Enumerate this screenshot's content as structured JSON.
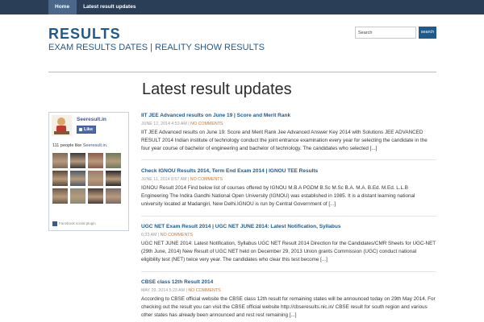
{
  "nav": {
    "home": "Home",
    "latest": "Latest result updates"
  },
  "header": {
    "title": "RESULTS",
    "description": "EXAM RESULTS DATES | REALITY SHOW RESULTS"
  },
  "search": {
    "value": "Search",
    "button": "search"
  },
  "page": {
    "title": "Latest result updates"
  },
  "facebook": {
    "page_name": "Seeresult.in",
    "like_label": "Like",
    "count_text": "111 people like ",
    "count_link": "Seeresult.in.",
    "plugin_text": "Facebook social plugin",
    "face_colors": [
      "#7d6a5a",
      "#3a3a3a",
      "#8a5a4a",
      "#6a7a5a",
      "#5a4a3a",
      "#4a5a6a",
      "#9a7a6a",
      "#2a2a2a",
      "#6a5a4a",
      "#8a8a7a",
      "#4a3a3a",
      "#7a6a6a"
    ]
  },
  "posts": [
    {
      "title": "IIT JEE Advanced results on June 19 | Score and Merit Rank",
      "date": "JUNE 12, 2014 4:53 AM | ",
      "comments": "NO COMMENTS",
      "excerpt": "IIT JEE Advanced results on June 19: Score and Merit Rank Jee Advanced Answer Key 2014 with Solutions JEE ADVANCED RESULT 2014 Indian institute of technology conduct the joint entrance examination every year for selecting the candidate in the four year course of bachelor of engineering and bachelor of technology. The candidates who selected [...]"
    },
    {
      "title": "Check IGNOU Results 2014, Term End Exam 2014 | IGNOU TEE Results",
      "date": "JUNE 11, 2014 8:57 AM | ",
      "comments": "NO COMMENTS",
      "excerpt": "IGNOU Result 2014 Find below list of courses offered by IGNOU M.B.A PGDM B.Sc M.Sc B.A. M.A. B.Ed. M.Ed. L.L.B Engineering The Indira Gandhi National Open University (IGNOU) was established in 1985. It is a distant learning national university located at Madangiri, New Delhi.IGNOU is run by Central Government of [...]"
    },
    {
      "title": "UGC NET Exam Result 2014 | UGC NET JUNE 2014: Latest Notification, Syllabus",
      "date": "6:33 AM | ",
      "comments": "NO COMMENTS",
      "excerpt": "UGC NET JUNE 2014: Latest Notification, Syllabus UGC NET Result 2014 Direction for the Candidates/CMR Sheets for UGC-NET (29th June, 2014) New Result of UGC NET held on December 29, 2013 Union grants Commission (UGC) conduct national eligibility test (NET) twice very year. The candidates who clear this test become [...]"
    },
    {
      "title": "CBSE class 12th Result 2014",
      "date": "MAY 29, 2014 5:23 AM | ",
      "comments": "NO COMMENTS",
      "excerpt": "According to CBSE official website the CBSE class 12th result for remaining states will be announced today on 29th May 2014. For checking out the result you can visit the CBSE official website http://cbseresults.nic.in/ CBSE result for south region and various other states has already been announced and rest rest remaining [...]"
    }
  ]
}
